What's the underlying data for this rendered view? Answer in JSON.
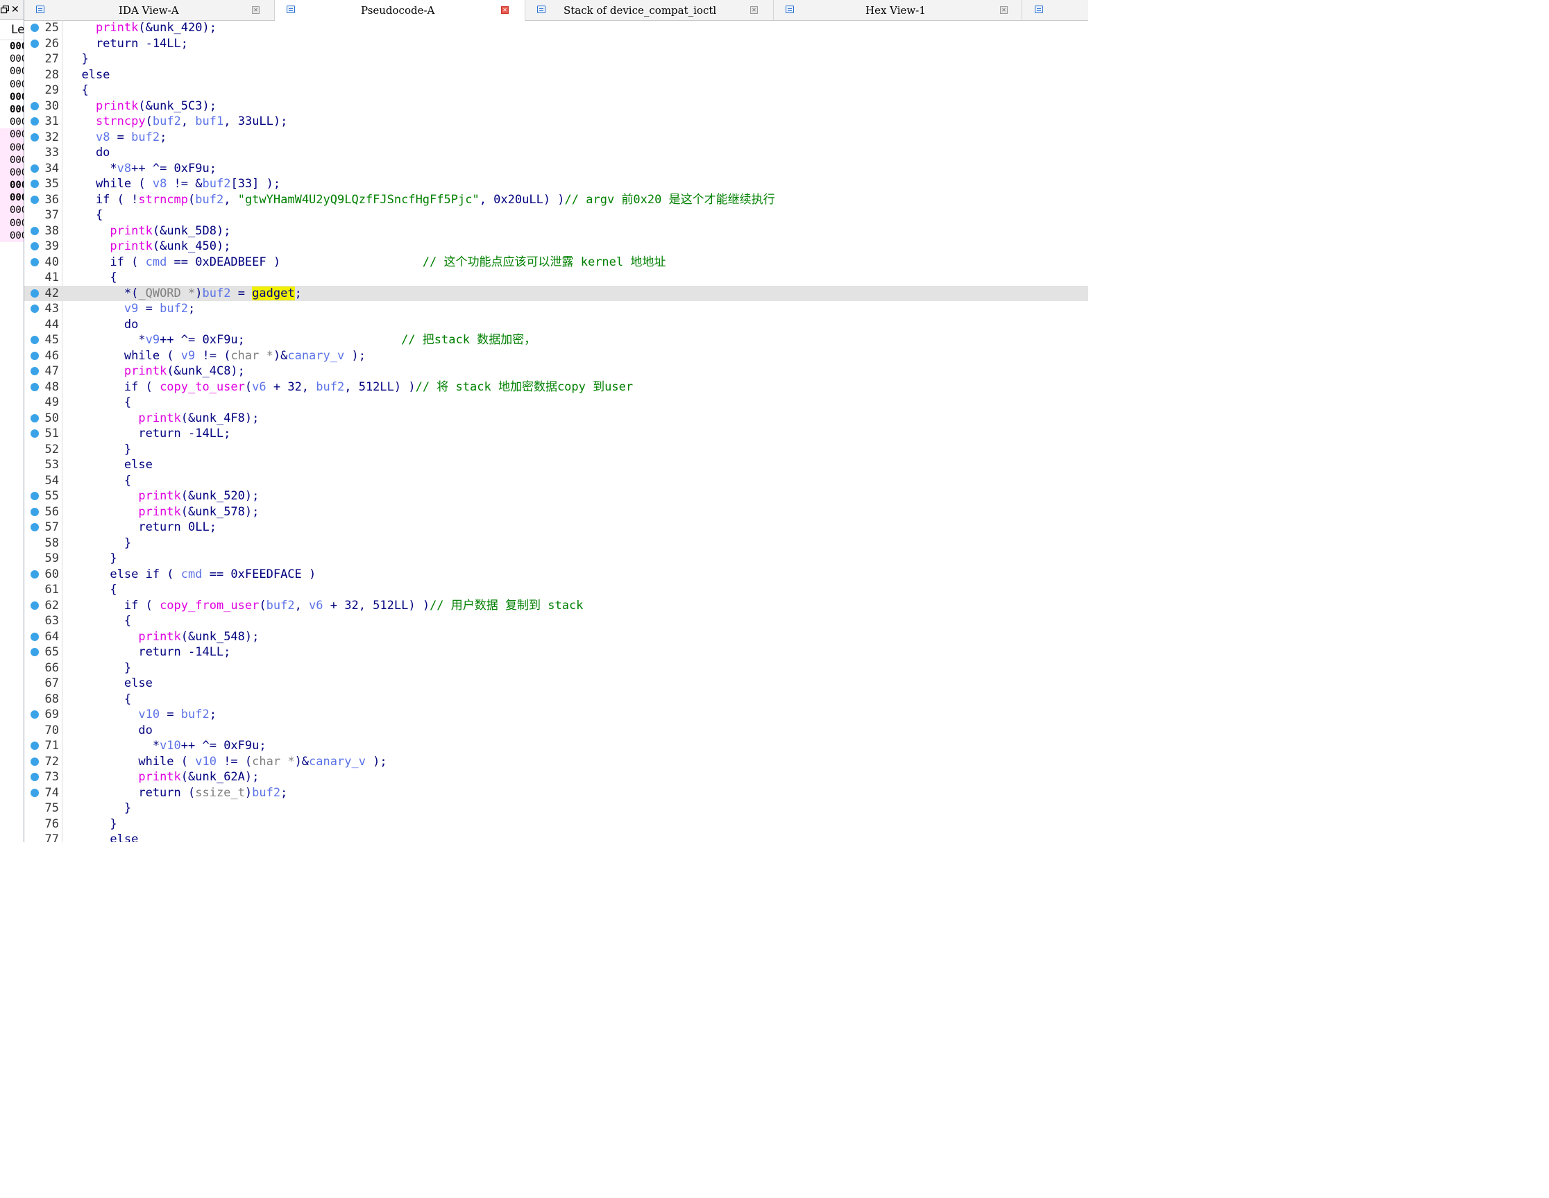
{
  "left_panel": {
    "header_icons": [
      "window-restore-icon",
      "close-icon"
    ],
    "close_glyph": "✕",
    "column_header": "Le",
    "rows": [
      {
        "text": "000",
        "bold": true,
        "pink": false
      },
      {
        "text": "000",
        "bold": false,
        "pink": false
      },
      {
        "text": "000",
        "bold": false,
        "pink": false
      },
      {
        "text": "000",
        "bold": false,
        "pink": false
      },
      {
        "text": "000",
        "bold": true,
        "pink": false
      },
      {
        "text": "000",
        "bold": true,
        "pink": false
      },
      {
        "text": "000",
        "bold": false,
        "pink": false
      },
      {
        "text": "000",
        "bold": false,
        "pink": true
      },
      {
        "text": "000",
        "bold": false,
        "pink": true
      },
      {
        "text": "000",
        "bold": false,
        "pink": true
      },
      {
        "text": "000",
        "bold": false,
        "pink": true
      },
      {
        "text": "000",
        "bold": true,
        "pink": true
      },
      {
        "text": "000",
        "bold": true,
        "pink": true
      },
      {
        "text": "000",
        "bold": false,
        "pink": true
      },
      {
        "text": "000",
        "bold": false,
        "pink": true
      },
      {
        "text": "000",
        "bold": false,
        "pink": true
      }
    ]
  },
  "tabs": [
    {
      "label": "IDA View-A",
      "active": false,
      "close_red": false
    },
    {
      "label": "Pseudocode-A",
      "active": true,
      "close_red": true
    },
    {
      "label": "Stack of device_compat_ioctl",
      "active": false,
      "close_red": false
    },
    {
      "label": "Hex View-1",
      "active": false,
      "close_red": false
    },
    {
      "label": "",
      "active": false,
      "close_red": false
    }
  ],
  "code": {
    "breakpoint_color": "#3aa3e8",
    "highlight_line": 42,
    "lines": [
      {
        "n": "25",
        "bp": true,
        "tokens": [
          [
            "p",
            "    "
          ],
          [
            "f",
            "printk"
          ],
          [
            "p",
            "(&unk_420);"
          ]
        ]
      },
      {
        "n": "26",
        "bp": true,
        "tokens": [
          [
            "p",
            "    return -14LL;"
          ]
        ]
      },
      {
        "n": "27",
        "bp": false,
        "tokens": [
          [
            "p",
            "  }"
          ]
        ]
      },
      {
        "n": "28",
        "bp": false,
        "tokens": [
          [
            "p",
            "  else"
          ]
        ]
      },
      {
        "n": "29",
        "bp": false,
        "tokens": [
          [
            "p",
            "  {"
          ]
        ]
      },
      {
        "n": "30",
        "bp": true,
        "tokens": [
          [
            "p",
            "    "
          ],
          [
            "f",
            "printk"
          ],
          [
            "p",
            "(&unk_5C3);"
          ]
        ]
      },
      {
        "n": "31",
        "bp": true,
        "tokens": [
          [
            "p",
            "    "
          ],
          [
            "f",
            "strncpy"
          ],
          [
            "p",
            "("
          ],
          [
            "v",
            "buf2"
          ],
          [
            "p",
            ", "
          ],
          [
            "v",
            "buf1"
          ],
          [
            "p",
            ", 33uLL);"
          ]
        ]
      },
      {
        "n": "32",
        "bp": true,
        "tokens": [
          [
            "p",
            "    "
          ],
          [
            "v",
            "v8"
          ],
          [
            "p",
            " = "
          ],
          [
            "v",
            "buf2"
          ],
          [
            "p",
            ";"
          ]
        ]
      },
      {
        "n": "33",
        "bp": false,
        "tokens": [
          [
            "p",
            "    do"
          ]
        ]
      },
      {
        "n": "34",
        "bp": true,
        "tokens": [
          [
            "p",
            "      *"
          ],
          [
            "v",
            "v8"
          ],
          [
            "p",
            "++ ^= 0xF9u;"
          ]
        ]
      },
      {
        "n": "35",
        "bp": true,
        "tokens": [
          [
            "p",
            "    while ( "
          ],
          [
            "v",
            "v8"
          ],
          [
            "p",
            " != &"
          ],
          [
            "v",
            "buf2"
          ],
          [
            "p",
            "[33] );"
          ]
        ]
      },
      {
        "n": "36",
        "bp": true,
        "tokens": [
          [
            "p",
            "    if ( !"
          ],
          [
            "f",
            "strncmp"
          ],
          [
            "p",
            "("
          ],
          [
            "v",
            "buf2"
          ],
          [
            "p",
            ", "
          ],
          [
            "s",
            "\"gtwYHamW4U2yQ9LQzfFJSncfHgFf5Pjc\""
          ],
          [
            "p",
            ", 0x20uLL) )"
          ],
          [
            "c",
            "// argv 前0x20 是这个才能继续执行"
          ]
        ]
      },
      {
        "n": "37",
        "bp": false,
        "tokens": [
          [
            "p",
            "    {"
          ]
        ]
      },
      {
        "n": "38",
        "bp": true,
        "tokens": [
          [
            "p",
            "      "
          ],
          [
            "f",
            "printk"
          ],
          [
            "p",
            "(&unk_5D8);"
          ]
        ]
      },
      {
        "n": "39",
        "bp": true,
        "tokens": [
          [
            "p",
            "      "
          ],
          [
            "f",
            "printk"
          ],
          [
            "p",
            "(&unk_450);"
          ]
        ]
      },
      {
        "n": "40",
        "bp": true,
        "tokens": [
          [
            "p",
            "      if ( "
          ],
          [
            "v",
            "cmd"
          ],
          [
            "p",
            " == 0xDEADBEEF )                    "
          ],
          [
            "c",
            "// 这个功能点应该可以泄露 kernel 地地址"
          ]
        ]
      },
      {
        "n": "41",
        "bp": false,
        "tokens": [
          [
            "p",
            "      {"
          ]
        ]
      },
      {
        "n": "42",
        "bp": true,
        "tokens": [
          [
            "p",
            "        *("
          ],
          [
            "g",
            "_QWORD *"
          ],
          [
            "p",
            ")"
          ],
          [
            "v",
            "buf2"
          ],
          [
            "p",
            " = "
          ],
          [
            "y",
            "gadget"
          ],
          [
            "p",
            ";"
          ]
        ]
      },
      {
        "n": "43",
        "bp": true,
        "tokens": [
          [
            "p",
            "        "
          ],
          [
            "v",
            "v9"
          ],
          [
            "p",
            " = "
          ],
          [
            "v",
            "buf2"
          ],
          [
            "p",
            ";"
          ]
        ]
      },
      {
        "n": "44",
        "bp": false,
        "tokens": [
          [
            "p",
            "        do"
          ]
        ]
      },
      {
        "n": "45",
        "bp": true,
        "tokens": [
          [
            "p",
            "          *"
          ],
          [
            "v",
            "v9"
          ],
          [
            "p",
            "++ ^= 0xF9u;                      "
          ],
          [
            "c",
            "// 把stack 数据加密，"
          ]
        ]
      },
      {
        "n": "46",
        "bp": true,
        "tokens": [
          [
            "p",
            "        while ( "
          ],
          [
            "v",
            "v9"
          ],
          [
            "p",
            " != ("
          ],
          [
            "g",
            "char *"
          ],
          [
            "p",
            ")&"
          ],
          [
            "v",
            "canary_v"
          ],
          [
            "p",
            " );"
          ]
        ]
      },
      {
        "n": "47",
        "bp": true,
        "tokens": [
          [
            "p",
            "        "
          ],
          [
            "f",
            "printk"
          ],
          [
            "p",
            "(&unk_4C8);"
          ]
        ]
      },
      {
        "n": "48",
        "bp": true,
        "tokens": [
          [
            "p",
            "        if ( "
          ],
          [
            "f",
            "copy_to_user"
          ],
          [
            "p",
            "("
          ],
          [
            "v",
            "v6"
          ],
          [
            "p",
            " + 32, "
          ],
          [
            "v",
            "buf2"
          ],
          [
            "p",
            ", 512LL) )"
          ],
          [
            "c",
            "// 将 stack 地加密数据copy 到user"
          ]
        ]
      },
      {
        "n": "49",
        "bp": false,
        "tokens": [
          [
            "p",
            "        {"
          ]
        ]
      },
      {
        "n": "50",
        "bp": true,
        "tokens": [
          [
            "p",
            "          "
          ],
          [
            "f",
            "printk"
          ],
          [
            "p",
            "(&unk_4F8);"
          ]
        ]
      },
      {
        "n": "51",
        "bp": true,
        "tokens": [
          [
            "p",
            "          return -14LL;"
          ]
        ]
      },
      {
        "n": "52",
        "bp": false,
        "tokens": [
          [
            "p",
            "        }"
          ]
        ]
      },
      {
        "n": "53",
        "bp": false,
        "tokens": [
          [
            "p",
            "        else"
          ]
        ]
      },
      {
        "n": "54",
        "bp": false,
        "tokens": [
          [
            "p",
            "        {"
          ]
        ]
      },
      {
        "n": "55",
        "bp": true,
        "tokens": [
          [
            "p",
            "          "
          ],
          [
            "f",
            "printk"
          ],
          [
            "p",
            "(&unk_520);"
          ]
        ]
      },
      {
        "n": "56",
        "bp": true,
        "tokens": [
          [
            "p",
            "          "
          ],
          [
            "f",
            "printk"
          ],
          [
            "p",
            "(&unk_578);"
          ]
        ]
      },
      {
        "n": "57",
        "bp": true,
        "tokens": [
          [
            "p",
            "          return 0LL;"
          ]
        ]
      },
      {
        "n": "58",
        "bp": false,
        "tokens": [
          [
            "p",
            "        }"
          ]
        ]
      },
      {
        "n": "59",
        "bp": false,
        "tokens": [
          [
            "p",
            "      }"
          ]
        ]
      },
      {
        "n": "60",
        "bp": true,
        "tokens": [
          [
            "p",
            "      else if ( "
          ],
          [
            "v",
            "cmd"
          ],
          [
            "p",
            " == 0xFEEDFACE )"
          ]
        ]
      },
      {
        "n": "61",
        "bp": false,
        "tokens": [
          [
            "p",
            "      {"
          ]
        ]
      },
      {
        "n": "62",
        "bp": true,
        "tokens": [
          [
            "p",
            "        if ( "
          ],
          [
            "f",
            "copy_from_user"
          ],
          [
            "p",
            "("
          ],
          [
            "v",
            "buf2"
          ],
          [
            "p",
            ", "
          ],
          [
            "v",
            "v6"
          ],
          [
            "p",
            " + 32, 512LL) )"
          ],
          [
            "c",
            "// 用户数据 复制到 stack"
          ]
        ]
      },
      {
        "n": "63",
        "bp": false,
        "tokens": [
          [
            "p",
            "        {"
          ]
        ]
      },
      {
        "n": "64",
        "bp": true,
        "tokens": [
          [
            "p",
            "          "
          ],
          [
            "f",
            "printk"
          ],
          [
            "p",
            "(&unk_548);"
          ]
        ]
      },
      {
        "n": "65",
        "bp": true,
        "tokens": [
          [
            "p",
            "          return -14LL;"
          ]
        ]
      },
      {
        "n": "66",
        "bp": false,
        "tokens": [
          [
            "p",
            "        }"
          ]
        ]
      },
      {
        "n": "67",
        "bp": false,
        "tokens": [
          [
            "p",
            "        else"
          ]
        ]
      },
      {
        "n": "68",
        "bp": false,
        "tokens": [
          [
            "p",
            "        {"
          ]
        ]
      },
      {
        "n": "69",
        "bp": true,
        "tokens": [
          [
            "p",
            "          "
          ],
          [
            "v",
            "v10"
          ],
          [
            "p",
            " = "
          ],
          [
            "v",
            "buf2"
          ],
          [
            "p",
            ";"
          ]
        ]
      },
      {
        "n": "70",
        "bp": false,
        "tokens": [
          [
            "p",
            "          do"
          ]
        ]
      },
      {
        "n": "71",
        "bp": true,
        "tokens": [
          [
            "p",
            "            *"
          ],
          [
            "v",
            "v10"
          ],
          [
            "p",
            "++ ^= 0xF9u;"
          ]
        ]
      },
      {
        "n": "72",
        "bp": true,
        "tokens": [
          [
            "p",
            "          while ( "
          ],
          [
            "v",
            "v10"
          ],
          [
            "p",
            " != ("
          ],
          [
            "g",
            "char *"
          ],
          [
            "p",
            ")&"
          ],
          [
            "v",
            "canary_v"
          ],
          [
            "p",
            " );"
          ]
        ]
      },
      {
        "n": "73",
        "bp": true,
        "tokens": [
          [
            "p",
            "          "
          ],
          [
            "f",
            "printk"
          ],
          [
            "p",
            "(&unk_62A);"
          ]
        ]
      },
      {
        "n": "74",
        "bp": true,
        "tokens": [
          [
            "p",
            "          return ("
          ],
          [
            "g",
            "ssize_t"
          ],
          [
            "p",
            ")"
          ],
          [
            "v",
            "buf2"
          ],
          [
            "p",
            ";"
          ]
        ]
      },
      {
        "n": "75",
        "bp": false,
        "tokens": [
          [
            "p",
            "        }"
          ]
        ]
      },
      {
        "n": "76",
        "bp": false,
        "tokens": [
          [
            "p",
            "      }"
          ]
        ]
      },
      {
        "n": "77",
        "bp": false,
        "tokens": [
          [
            "p",
            "      else"
          ]
        ]
      }
    ]
  }
}
